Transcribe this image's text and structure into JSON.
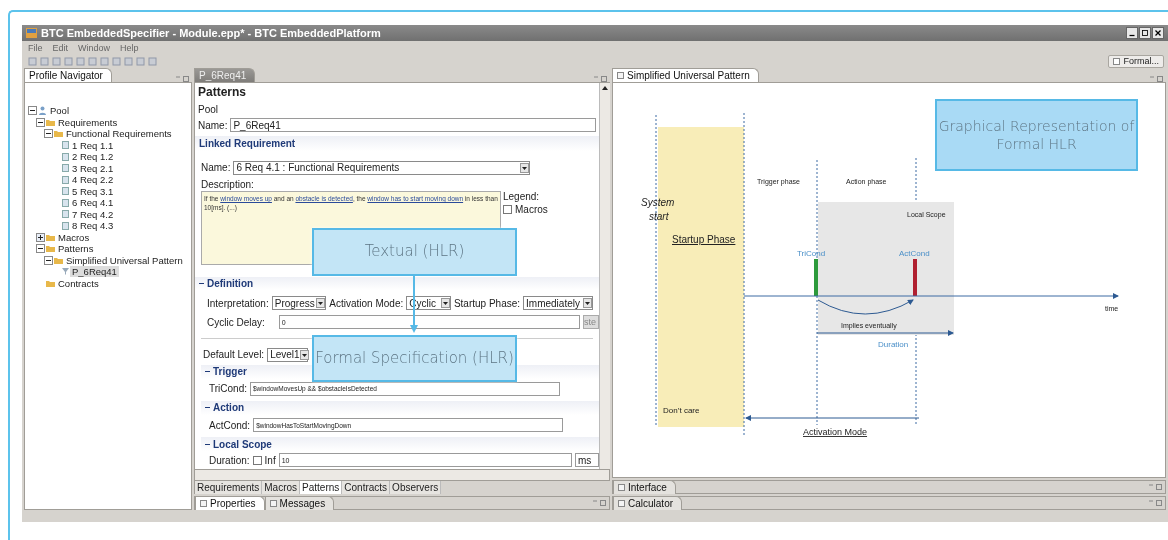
{
  "window": {
    "title": "BTC EmbeddedSpecifier - Module.epp* - BTC EmbeddedPlatform"
  },
  "menu": [
    "File",
    "Edit",
    "Window",
    "Help"
  ],
  "perspective": {
    "label": "Formal..."
  },
  "navigator": {
    "title": "Profile Navigator",
    "tree": [
      {
        "label": "Pool",
        "kind": "pool",
        "expanded": true,
        "selected": false,
        "children": [
          {
            "label": "Requirements",
            "kind": "folder",
            "expanded": true,
            "selected": false,
            "children": [
              {
                "label": "Functional Requirements",
                "kind": "folder",
                "expanded": true,
                "selected": false,
                "children": [
                  {
                    "label": "1 Req 1.1",
                    "kind": "requirement",
                    "selected": false
                  },
                  {
                    "label": "2 Req 1.2",
                    "kind": "requirement",
                    "selected": false
                  },
                  {
                    "label": "3 Req 2.1",
                    "kind": "requirement",
                    "selected": false
                  },
                  {
                    "label": "4 Req 2.2",
                    "kind": "requirement",
                    "selected": false
                  },
                  {
                    "label": "5 Req 3.1",
                    "kind": "requirement",
                    "selected": false
                  },
                  {
                    "label": "6 Req 4.1",
                    "kind": "requirement",
                    "selected": false
                  },
                  {
                    "label": "7 Req 4.2",
                    "kind": "requirement",
                    "selected": false
                  },
                  {
                    "label": "8 Req 4.3",
                    "kind": "requirement",
                    "selected": false
                  }
                ]
              }
            ]
          },
          {
            "label": "Macros",
            "kind": "folder",
            "expanded": false,
            "selected": false
          },
          {
            "label": "Patterns",
            "kind": "folder",
            "expanded": true,
            "selected": false,
            "children": [
              {
                "label": "Simplified Universal Pattern",
                "kind": "folder",
                "expanded": true,
                "selected": false,
                "children": [
                  {
                    "label": "P_6Req41",
                    "kind": "pattern",
                    "selected": true
                  }
                ]
              }
            ]
          },
          {
            "label": "Contracts",
            "kind": "folder",
            "selected": false
          }
        ]
      }
    ]
  },
  "editor": {
    "tab": "P_6Req41",
    "heading": "Patterns",
    "path": "Pool",
    "name": {
      "label": "Name:",
      "value": "P_6Req41"
    },
    "linked_requirement": {
      "title": "Linked Requirement",
      "name": {
        "label": "Name:",
        "value": "6 Req 4.1 : Functional Requirements"
      },
      "description_label": "Description:",
      "description": [
        {
          "text": "If the ",
          "link": false
        },
        {
          "text": "window moves up",
          "link": true
        },
        {
          "text": " and an ",
          "link": false
        },
        {
          "text": "obstacle is detected",
          "link": true
        },
        {
          "text": ", the ",
          "link": false
        },
        {
          "text": "window has to start moving down",
          "link": true
        },
        {
          "text": " in less than 10[ms]. (...)",
          "link": false
        }
      ],
      "legend": {
        "label": "Legend:",
        "item": {
          "label": "Macros",
          "checked": false
        }
      }
    },
    "definition": {
      "title": "Definition",
      "expanded": true,
      "selects": [
        {
          "label": "Interpretation:",
          "value": "Progress"
        },
        {
          "label": "Activation Mode:",
          "value": "Cyclic"
        },
        {
          "label": "Startup Phase:",
          "value": "Immediately"
        }
      ],
      "cyclic_delay": {
        "label": "Cyclic Delay:",
        "value": "0",
        "button": "ste"
      }
    },
    "default_level": {
      "label": "Default Level:",
      "value": "Level1"
    },
    "conditions": [
      {
        "title": "Trigger",
        "expanded": true,
        "label": "TriCond:",
        "value": "$windowMovesUp && $obstacleIsDetected"
      },
      {
        "title": "Action",
        "expanded": true,
        "label": "ActCond:",
        "value": "$windowHasToStartMovingDown"
      }
    ],
    "local_scope": {
      "title": "Local Scope",
      "expanded": true,
      "label": "Duration:",
      "inf": {
        "label": "Inf",
        "checked": false
      },
      "value": "10",
      "unit": "ms"
    },
    "page_tabs": [
      {
        "label": "Requirements",
        "selected": false
      },
      {
        "label": "Macros",
        "selected": false
      },
      {
        "label": "Patterns",
        "selected": true
      },
      {
        "label": "Contracts",
        "selected": false
      },
      {
        "label": "Observers",
        "selected": false
      }
    ]
  },
  "bottom_views": [
    {
      "label": "Properties",
      "selected": true
    },
    {
      "label": "Messages",
      "selected": false
    }
  ],
  "diagram_view": {
    "title": "Simplified Universal Pattern",
    "system_start": "System start",
    "startup_phase": "Startup Phase",
    "dont_care": "Don’t care",
    "trigger_phase": "Trigger phase",
    "action_phase": "Action phase",
    "local_scope": "Local Scope",
    "trigger_condition": "TriCond",
    "action_condition": "ActCond",
    "implies": "Implies eventually",
    "duration": "Duration",
    "time_axis": "time",
    "activation_mode": "Activation Mode"
  },
  "side_views": [
    "Interface",
    "Calculator"
  ],
  "callouts": [
    {
      "text": "Textual (HLR)"
    },
    {
      "text": "Formal Specification (HLR)"
    },
    {
      "text": "Graphical Representation of Formal HLR"
    }
  ]
}
